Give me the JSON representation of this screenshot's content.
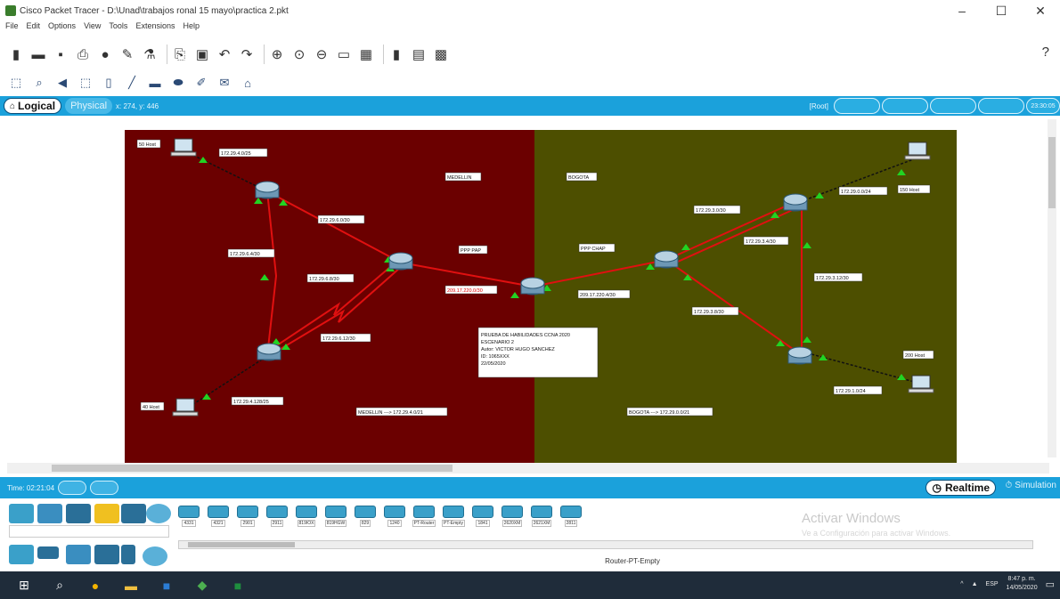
{
  "window": {
    "title": "Cisco Packet Tracer - D:\\Unad\\trabajos ronal 15 mayo\\practica 2.pkt",
    "controls": [
      "–",
      "☐",
      "✕"
    ]
  },
  "menu": [
    "File",
    "Edit",
    "Options",
    "View",
    "Tools",
    "Extensions",
    "Help"
  ],
  "toolbar": {
    "icons": [
      "new-file-icon",
      "open-folder-icon",
      "save-icon",
      "print-icon",
      "info-icon",
      "activity-wizard-icon",
      "network-info-icon",
      "copy-icon",
      "paste-icon",
      "undo-icon",
      "redo-icon",
      "zoom-in-icon",
      "zoom-reset-icon",
      "zoom-out-icon",
      "drawing-palette-icon",
      "custom-device-icon",
      "cluster-icon",
      "pdu-icon",
      "notes-icon"
    ],
    "help": "?"
  },
  "toolbar2": {
    "icons": [
      "select-icon",
      "search-icon",
      "inspect-icon",
      "move-icon",
      "delete-icon",
      "line-icon",
      "rectangle-icon",
      "ellipse-icon",
      "freeform-icon",
      "pdu-simple-icon",
      "pdu-complex-icon"
    ]
  },
  "workspace_bar": {
    "logical": "Logical",
    "physical": "Physical",
    "coords": "x: 274, y: 446",
    "root": "[Root]",
    "time_label": "23:30:05"
  },
  "topology": {
    "regions": [
      {
        "name": "MEDELLIN",
        "color": "#6b0000"
      },
      {
        "name": "BOGOTA",
        "color": "#4d4f00"
      }
    ],
    "labels": {
      "medellin": "MEDELLIN",
      "bogota": "BOGOTA",
      "host50": "50 Host",
      "host40": "40 Host",
      "host150": "150 Host",
      "host200": "200 Host",
      "net_m1": "172.29.4.0/25",
      "net_m2": "172.29.6.0/30",
      "net_m3": "172.29.6.4/30",
      "net_m4": "172.29.6.8/30",
      "net_m5": "172.29.6.12/30",
      "net_m6": "172.29.4.128/25",
      "ppp_pap": "PPP PAP",
      "ppp_chap": "PPP CHAP",
      "wan1": "209.17.220.0/30",
      "wan2": "209.17.220.4/30",
      "net_b1": "172.29.3.0/30",
      "net_b2": "172.29.3.4/30",
      "net_b3": "172.29.0.0/24",
      "net_b4": "172.29.3.12/30",
      "net_b5": "172.29.3.8/30",
      "net_b6": "172.29.1.0/24",
      "sum_m": "MEDELLIN ---> 172.29.4.0/21",
      "sum_b": "BOGOTA ---> 172.29.0.0/21"
    },
    "note": [
      "PRUEBA DE HABILIDADES CCNA 2020",
      "ESCENARIO 2",
      "Autor: VICTOR HUGO SANCHEZ",
      "ID: 1065XXX",
      "22/05/2020"
    ]
  },
  "statusbar": {
    "time": "Time: 02:21:04",
    "realtime": "Realtime",
    "simulation": "Simulation"
  },
  "palette": {
    "devices": [
      "4331",
      "4321",
      "2901",
      "2911",
      "819IOX",
      "819HGW",
      "829",
      "1240",
      "PT-Router",
      "PT-Empty",
      "1841",
      "2620XM",
      "2621XM",
      "2811"
    ],
    "selected_name": "Router-PT-Empty",
    "watermark_title": "Activar Windows",
    "watermark_sub": "Ve a Configuración para activar Windows."
  },
  "taskbar": {
    "lang": "ESP",
    "time": "8:47 p. m.",
    "date": "14/05/2020"
  }
}
